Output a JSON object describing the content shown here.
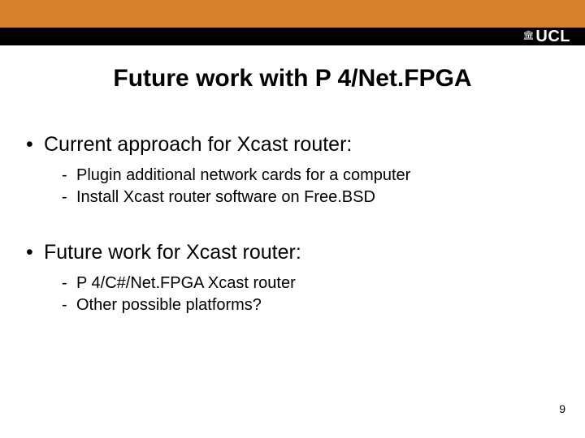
{
  "header": {
    "logo_text": "UCL",
    "logo_icon": "🏛"
  },
  "title": "Future work with P 4/Net.FPGA",
  "content": {
    "section1": {
      "heading": "Current approach for Xcast router:",
      "items": [
        "Plugin additional network cards for a computer",
        "Install Xcast router software on Free.BSD"
      ]
    },
    "section2": {
      "heading": "Future work for Xcast router:",
      "items": [
        "P 4/C#/Net.FPGA Xcast router",
        "Other possible platforms?"
      ]
    }
  },
  "page_number": "9"
}
